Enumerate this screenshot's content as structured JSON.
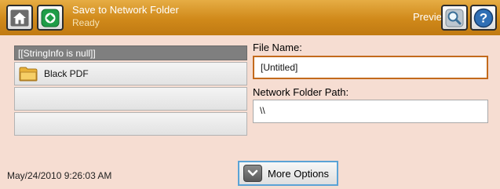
{
  "header": {
    "title": "Save to Network Folder",
    "subtitle": "Ready",
    "preview_label": "Preview",
    "icons": {
      "home": "home-icon",
      "start": "start-icon",
      "preview": "magnifier-icon",
      "help": "help-icon"
    },
    "colors": {
      "bar": "#d0891a",
      "start_green": "#1f9d48",
      "help_blue": "#2f6fb5"
    }
  },
  "list": {
    "header": "[[StringInfo is null]]",
    "rows": [
      {
        "label": "Black PDF",
        "icon": "folder-icon"
      },
      {
        "label": ""
      },
      {
        "label": ""
      }
    ]
  },
  "fields": {
    "file_name_label": "File Name:",
    "file_name_value": "[Untitled]",
    "folder_path_label": "Network Folder Path:",
    "folder_path_value": "\\\\"
  },
  "footer": {
    "datetime": "May/24/2010 9:26:03 AM",
    "more_options_label": "More Options",
    "more_options_icon": "chevron-down-icon"
  }
}
